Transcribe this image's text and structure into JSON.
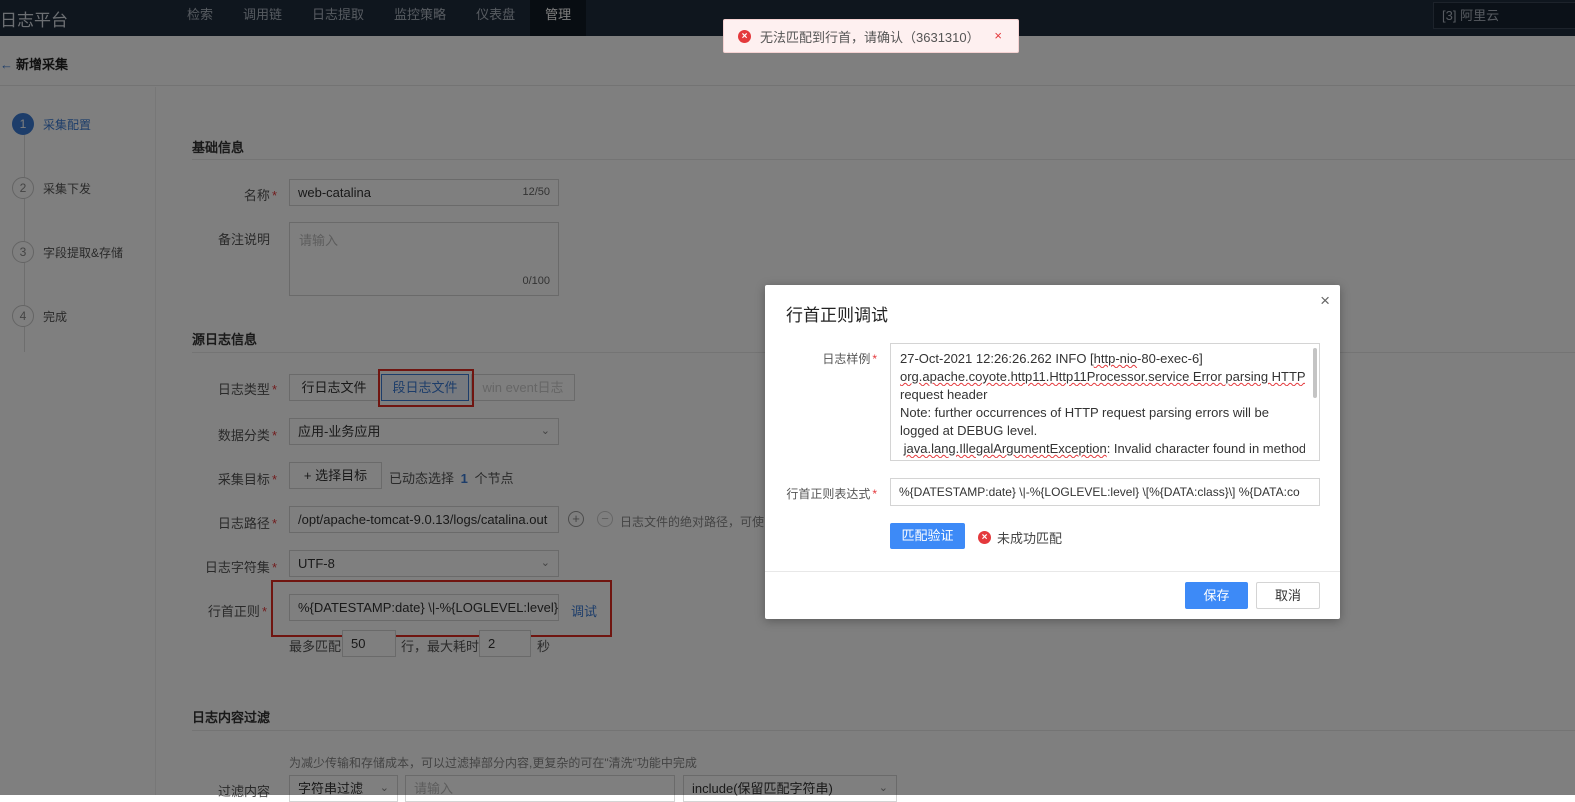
{
  "app": {
    "brand": "日志平台",
    "nav": [
      "检索",
      "调用链",
      "日志提取",
      "监控策略",
      "仪表盘",
      "管理"
    ],
    "active_nav": "管理",
    "tenant": "[3] 阿里云"
  },
  "page": {
    "back_title": "新增采集"
  },
  "steps": [
    {
      "num": "1",
      "label": "采集配置"
    },
    {
      "num": "2",
      "label": "采集下发"
    },
    {
      "num": "3",
      "label": "字段提取&存储"
    },
    {
      "num": "4",
      "label": "完成"
    }
  ],
  "basic": {
    "title": "基础信息",
    "name_label": "名称",
    "name_value": "web-catalina",
    "name_count": "12/50",
    "remark_label": "备注说明",
    "remark_placeholder": "请输入",
    "remark_count": "0/100"
  },
  "source": {
    "title": "源日志信息",
    "log_type_label": "日志类型",
    "log_types": [
      "行日志文件",
      "段日志文件",
      "win event日志"
    ],
    "category_label": "数据分类",
    "category_value": "应用-业务应用",
    "target_label": "采集目标",
    "target_button": "+ 选择目标",
    "target_text_prefix": "已动态选择",
    "target_count": "1",
    "target_text_suffix": "个节点",
    "path_label": "日志路径",
    "path_value": "/opt/apache-tomcat-9.0.13/logs/catalina.out",
    "path_hint": "日志文件的绝对路径，可使",
    "charset_label": "日志字符集",
    "charset_value": "UTF-8",
    "regex_label": "行首正则",
    "regex_value": "%{DATESTAMP:date} \\|-%{LOGLEVEL:level} \\|",
    "debug_link": "调试",
    "max_match_prefix": "最多匹配",
    "max_match_value": "50",
    "max_match_mid": "行，最大耗时",
    "max_time_value": "2",
    "max_time_suffix": "秒"
  },
  "filter": {
    "title": "日志内容过滤",
    "hint": "为减少传输和存储成本，可以过滤掉部分内容,更复杂的可在\"清洗\"功能中完成",
    "label": "过滤内容",
    "type_value": "字符串过滤",
    "input_placeholder": "请输入",
    "mode_value": "include(保留匹配字符串)"
  },
  "toast": {
    "message": "无法匹配到行首，请确认（3631310）"
  },
  "modal": {
    "title": "行首正则调试",
    "sample_label": "日志样例",
    "sample_lines": [
      "27-Oct-2021 12:26:26.262 INFO [http-nio-80-exec-6]",
      "org.apache.coyote.http11.Http11Processor.service Error parsing HTTP",
      "request header",
      " Note: further occurrences of HTTP request parsing errors will be",
      "logged at DEBUG level.",
      " java.lang.IllegalArgumentException: Invalid character found in method"
    ],
    "regex_label": "行首正则表达式",
    "regex_value": "%{DATESTAMP:date} \\|-%{LOGLEVEL:level} \\[%{DATA:class}\\] %{DATA:co",
    "verify_button": "匹配验证",
    "match_status": "未成功匹配",
    "save_button": "保存",
    "cancel_button": "取消"
  },
  "colors": {
    "nav_bg": "#1f2d3d",
    "primary": "#3d8af7",
    "error": "#e4393c",
    "highlight_box": "#e02b20"
  }
}
